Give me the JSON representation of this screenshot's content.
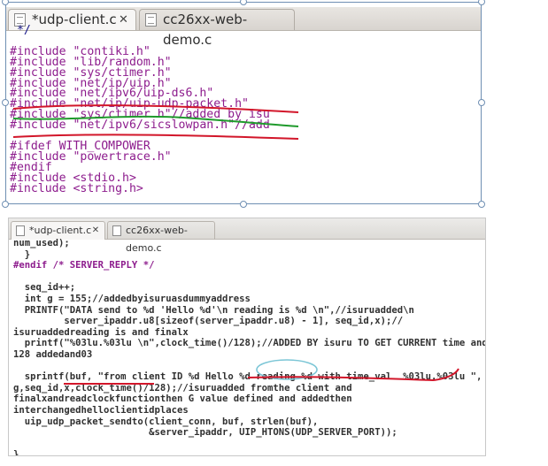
{
  "top_editor": {
    "tabs": [
      {
        "label": "*udp-client.c",
        "active": true
      },
      {
        "label": "cc26xx-web-demo.c",
        "active": false
      }
    ],
    "lines": [
      " */",
      "",
      "#include \"contiki.h\"",
      "#include \"lib/random.h\"",
      "#include \"sys/ctimer.h\"",
      "#include \"net/ip/uip.h\"",
      "#include \"net/ipv6/uip-ds6.h\"",
      "#include \"net/ip/uip-udp-packet.h\"",
      "#include \"sys/ctimer.h\"//added by isu",
      "#include \"net/ipv6/sicslowpan.h\"//add",
      "",
      "#ifdef WITH_COMPOWER",
      "#include \"powertrace.h\"",
      "#endif",
      "#include <stdio.h>",
      "#include <string.h>"
    ]
  },
  "bottom_editor": {
    "tabs": [
      {
        "label": "*udp-client.c",
        "active": true
      },
      {
        "label": "cc26xx-web-demo.c",
        "active": false
      }
    ],
    "lines": [
      "num_used);",
      "  }",
      "#endif /* SERVER_REPLY */",
      "",
      "  seq_id++;",
      "  int g = 155;//addedbyisuruasdummyaddress",
      "  PRINTF(\"DATA send to %d 'Hello %d'\\n reading is %d \\n\",//isuruadded\\n",
      "         server_ipaddr.u8[sizeof(server_ipaddr.u8) - 1], seq_id,x);//",
      "isuruaddedreading is and finalx",
      "  printf(\"%03lu.%03lu \\n\",clock_time()/128);//ADDED BY isuru TO GET CURRENT time and",
      "128 addedand03",
      "",
      "  sprintf(buf, \"from client ID %d Hello %d reading %d with time_val  %03lu.%03lu \",",
      "g,seq_id,x,clock_time()/128);//isuruadded fromthe client and",
      "finalxandreadclockfunctionthen G value defined and addedthen",
      "interchangedhelloclientidplaces",
      "  uip_udp_packet_sendto(client_conn, buf, strlen(buf),",
      "                        &server_ipaddr, UIP_HTONS(UDP_SERVER_PORT));",
      "",
      "}"
    ]
  },
  "colors": {
    "preprocessor": "#8d1c8d",
    "comment_top": "#1a1a8a",
    "keyword": "#2a7d2a",
    "string": "#c01e1e",
    "text": "#303030",
    "annotation_red": "#d2162a",
    "annotation_green": "#1f9a2c",
    "annotation_cyan": "#7cc6d6",
    "selection_frame": "#6f8fb3"
  },
  "icons": [
    "file-icon",
    "close-icon"
  ]
}
